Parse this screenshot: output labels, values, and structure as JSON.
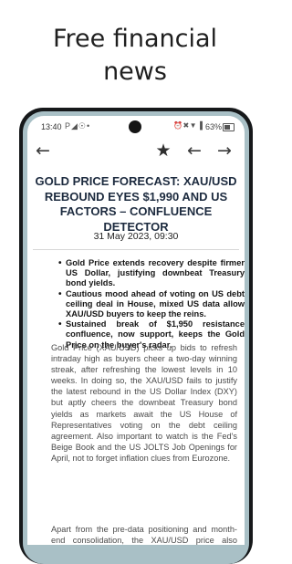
{
  "promo": {
    "line1": "Free financial",
    "line2": "news"
  },
  "status_bar": {
    "time": "13:40",
    "left_icons": "P◢☉•",
    "right_icons": "⏰✖▼▐",
    "battery": "63%"
  },
  "toolbar": {
    "back_icon": "arrow-left-icon",
    "star_icon": "star-icon",
    "prev_icon": "arrow-left-icon",
    "next_icon": "arrow-right-icon"
  },
  "article": {
    "headline": "GOLD PRICE FORECAST: XAU/USD REBOUND EYES $1,990 AND US FACTORS – CONFLUENCE DETECTOR",
    "date": "31 May 2023, 09:30",
    "bullets": [
      "Gold Price extends recovery despite firmer US Dollar, justifying downbeat Treasury bond yields.",
      "Cautious mood ahead of voting on US debt ceiling deal in House, mixed US data allow XAU/USD buyers to keep the reins.",
      "Sustained break of $1,950 resistance confluence, now support, keeps the Gold Price on the buyer's radar."
    ],
    "paragraphs": [
      "Gold Price (XAU/USD) picks up bids to refresh intraday high as buyers cheer a two-day winning streak, after refreshing the lowest levels in 10 weeks. In doing so, the XAU/USD fails to justify the latest rebound in the US Dollar Index (DXY) but aptly cheers the downbeat Treasury bond yields as markets await the US House of Representatives voting on the debt ceiling agreement. Also important to watch is the Fed's Beige Book and the US JOLTS Job Openings for April, not to forget inflation clues from Eurozone.",
      "Apart from the pre-data positioning and month-end consolidation, the XAU/USD price also benefits from the mixed US data, as well as China's readiness for more stimulus"
    ]
  },
  "colors": {
    "phone_frame": "#16181a",
    "phone_edge": "#a9c0c6",
    "headline": "#1d2b3f"
  }
}
